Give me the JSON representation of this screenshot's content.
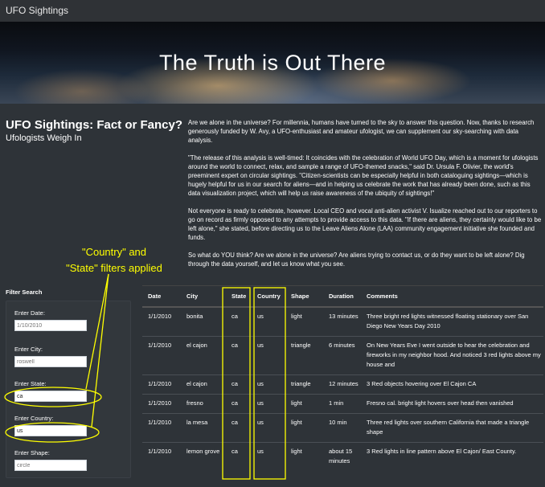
{
  "navbar": {
    "brand": "UFO Sightings"
  },
  "hero": {
    "title": "The Truth is Out There"
  },
  "intro": {
    "heading": "UFO Sightings: Fact or Fancy?",
    "subheading": "Ufologists Weigh In"
  },
  "article": {
    "paragraphs": [
      "Are we alone in the universe? For millennia, humans have turned to the sky to answer this question. Now, thanks to research generously funded by W. Avy, a UFO-enthusiast and amateur ufologist, we can supplement our sky-searching with data analysis.",
      "\"The release of this analysis is well-timed: It coincides with the celebration of World UFO Day, which is a moment for ufologists around the world to connect, relax, and sample a range of UFO-themed snacks,\" said Dr. Ursula F. Olivier, the world's preeminent expert on circular sightings. \"Citizen-scientists can be especially helpful in both cataloguing sightings—which is hugely helpful for us in our search for aliens—and in helping us celebrate the work that has already been done, such as this data visualization project, which will help us raise awareness of the ubiquity of sightings!\"",
      "Not everyone is ready to celebrate, however. Local CEO and vocal anti-alien activist V. Isualize reached out to our reporters to go on record as firmly opposed to any attempts to provide access to this data. \"If there are aliens, they certainly would like to be left alone,\" she stated, before directing us to the Leave Aliens Alone (LAA) community engagement initiative she founded and funds.",
      "So what do YOU think? Are we alone in the universe? Are aliens trying to contact us, or do they want to be left alone? Dig through the data yourself, and let us know what you see."
    ]
  },
  "filters": {
    "title": "Filter Search",
    "date": {
      "label": "Enter Date:",
      "placeholder": "1/10/2010",
      "value": ""
    },
    "city": {
      "label": "Enter City:",
      "placeholder": "roswell",
      "value": ""
    },
    "state": {
      "label": "Enter State:",
      "placeholder": "",
      "value": "ca"
    },
    "country": {
      "label": "Enter Country:",
      "placeholder": "",
      "value": "us"
    },
    "shape": {
      "label": "Enter Shape:",
      "placeholder": "circle",
      "value": ""
    }
  },
  "table": {
    "headers": [
      "Date",
      "City",
      "State",
      "Country",
      "Shape",
      "Duration",
      "Comments"
    ],
    "rows": [
      [
        "1/1/2010",
        "bonita",
        "ca",
        "us",
        "light",
        "13 minutes",
        "Three bright red lights witnessed floating stationary over San Diego New Years Day 2010"
      ],
      [
        "1/1/2010",
        "el cajon",
        "ca",
        "us",
        "triangle",
        "6 minutes",
        "On New Years Eve I went outside to hear the celebration and fireworks in my neighbor hood. And noticed 3 red lights above my house and"
      ],
      [
        "1/1/2010",
        "el cajon",
        "ca",
        "us",
        "triangle",
        "12 minutes",
        "3 Red objects hovering over El Cajon CA"
      ],
      [
        "1/1/2010",
        "fresno",
        "ca",
        "us",
        "light",
        "1 min",
        "Fresno cal. bright light hovers over head then vanished"
      ],
      [
        "1/1/2010",
        "la mesa",
        "ca",
        "us",
        "light",
        "10 min",
        "Three red lights over southern California that made a triangle shape"
      ],
      [
        "1/1/2010",
        "lemon grove",
        "ca",
        "us",
        "light",
        "about 15 minutes",
        "3 Red lights in line pattern above El Cajon/ East County."
      ]
    ]
  },
  "annotation": {
    "line1": "\"Country\" and",
    "line2": "\"State\" filters applied",
    "color": "#ffff00"
  }
}
